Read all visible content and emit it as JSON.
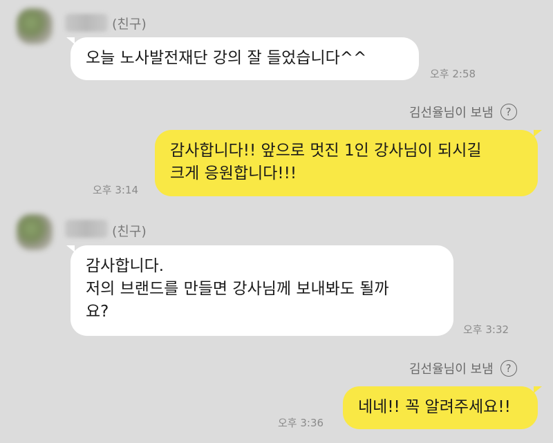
{
  "messages": [
    {
      "friend_tag": "(친구)",
      "lines": [
        "오늘 노사발전재단 강의 잘 들었습니다^^"
      ],
      "time": "오후 2:58"
    },
    {
      "sent_by": "김선율님이 보냄",
      "lines": [
        "감사합니다!! 앞으로 멋진 1인 강사님이 되시길",
        "크게 응원합니다!!!"
      ],
      "time": "오후 3:14"
    },
    {
      "friend_tag": "(친구)",
      "lines": [
        "감사합니다.",
        "저의 브랜드를 만들면 강사님께 보내봐도 될까",
        "요?"
      ],
      "time": "오후 3:32"
    },
    {
      "sent_by": "김선율님이 보냄",
      "lines": [
        "네네!! 꼭 알려주세요!!"
      ],
      "time": "오후 3:36"
    }
  ],
  "help_icon_glyph": "?",
  "colors": {
    "background": "#dcdcdc",
    "sent_bubble": "#f9e845",
    "received_bubble": "#ffffff"
  }
}
